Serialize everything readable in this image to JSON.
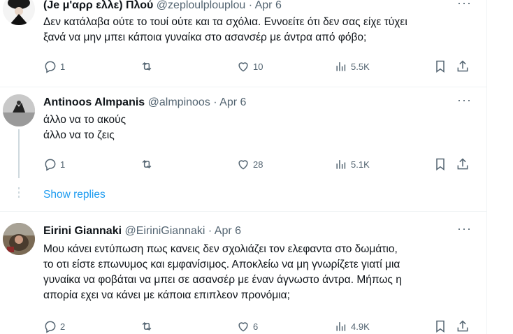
{
  "tweets": [
    {
      "name": "(Je μ'αρρ ελλε) Πλού",
      "handle": "@zeploulplouplou",
      "sep": "·",
      "date": "Apr 6",
      "lines": [
        "Δεν κατάλαβα ούτε το τουί ούτε και τα σχόλια. Εννοείτε ότι δεν σας είχε τύχει",
        "ξανά να μην μπει κάποια γυναίκα στο ασανσέρ με άντρα από φόβο;"
      ],
      "replies": "1",
      "reposts": "",
      "likes": "10",
      "views": "5.5K"
    },
    {
      "name": "Antinoos Almpanis",
      "handle": "@almpinoos",
      "sep": "·",
      "date": "Apr 6",
      "lines": [
        "άλλο να το ακούς",
        "άλλο να το ζεις"
      ],
      "replies": "1",
      "reposts": "",
      "likes": "28",
      "views": "5.1K"
    },
    {
      "name": "Eirini Giannaki",
      "handle": "@EiriniGiannaki",
      "sep": "·",
      "date": "Apr 6",
      "lines": [
        "Μου κάνει εντύπωση πως κανεις δεν σχολιάζει τον ελεφαντα στο δωμάτιο,",
        "το οτι είστε επωνυμος και εμφανίσιμος. Αποκλείω να μη γνωρίζετε γιατί μια",
        "γυναίκα να φοβάται να μπει σε ασανσέρ με έναν άγνωστο άντρα. Μήπως η",
        "απορία εχει να κάνει με κάποια επιπλεον προνόμια;"
      ],
      "replies": "2",
      "reposts": "",
      "likes": "6",
      "views": "4.9K"
    }
  ],
  "show_replies": "Show replies",
  "more_glyph": "···",
  "colors": {
    "accent": "#1d9bf0",
    "muted": "#536471",
    "text": "#0f1419",
    "divider": "#eff3f4"
  }
}
